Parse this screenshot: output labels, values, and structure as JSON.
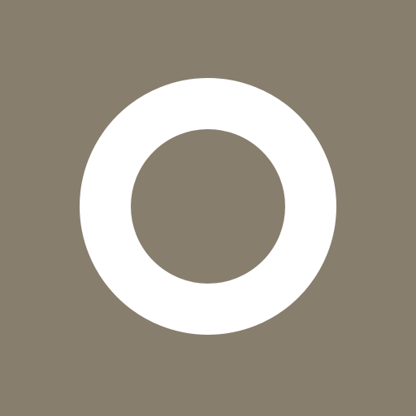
{
  "app_icon": {
    "icon": "ring-icon",
    "colors": {
      "background": "#887e6e",
      "ring": "#ffffff"
    }
  }
}
